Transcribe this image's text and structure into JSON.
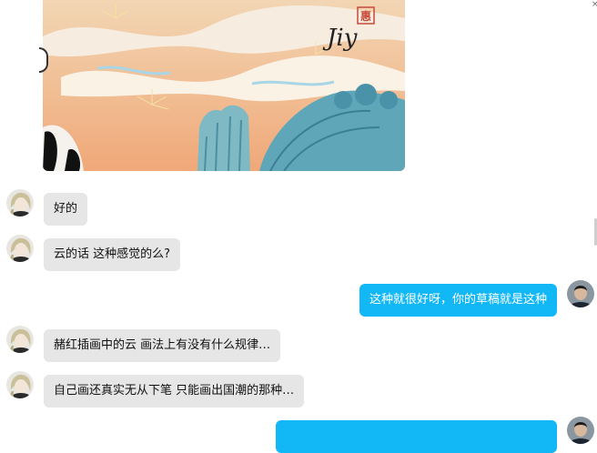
{
  "image_message": {
    "stamp_text": "惠",
    "signature_text": "Jiy"
  },
  "messages": [
    {
      "side": "in",
      "text": "好的"
    },
    {
      "side": "in",
      "text": "云的话 这种感觉的么?"
    },
    {
      "side": "out",
      "text": "这种就很好呀，你的草稿就是这种"
    },
    {
      "side": "in",
      "text": "赭红插画中的云  画法上有没有什么规律…"
    },
    {
      "side": "in",
      "text": "自己画还真实无从下笔  只能画出国潮的那种…"
    },
    {
      "side": "out",
      "text": ""
    }
  ],
  "icons": {
    "zoom": "zoom-in-icon",
    "sender_avatar": "avatar-icon"
  },
  "colors": {
    "incoming_bubble": "#e6e6e6",
    "outgoing_bubble": "#12b7f5"
  }
}
